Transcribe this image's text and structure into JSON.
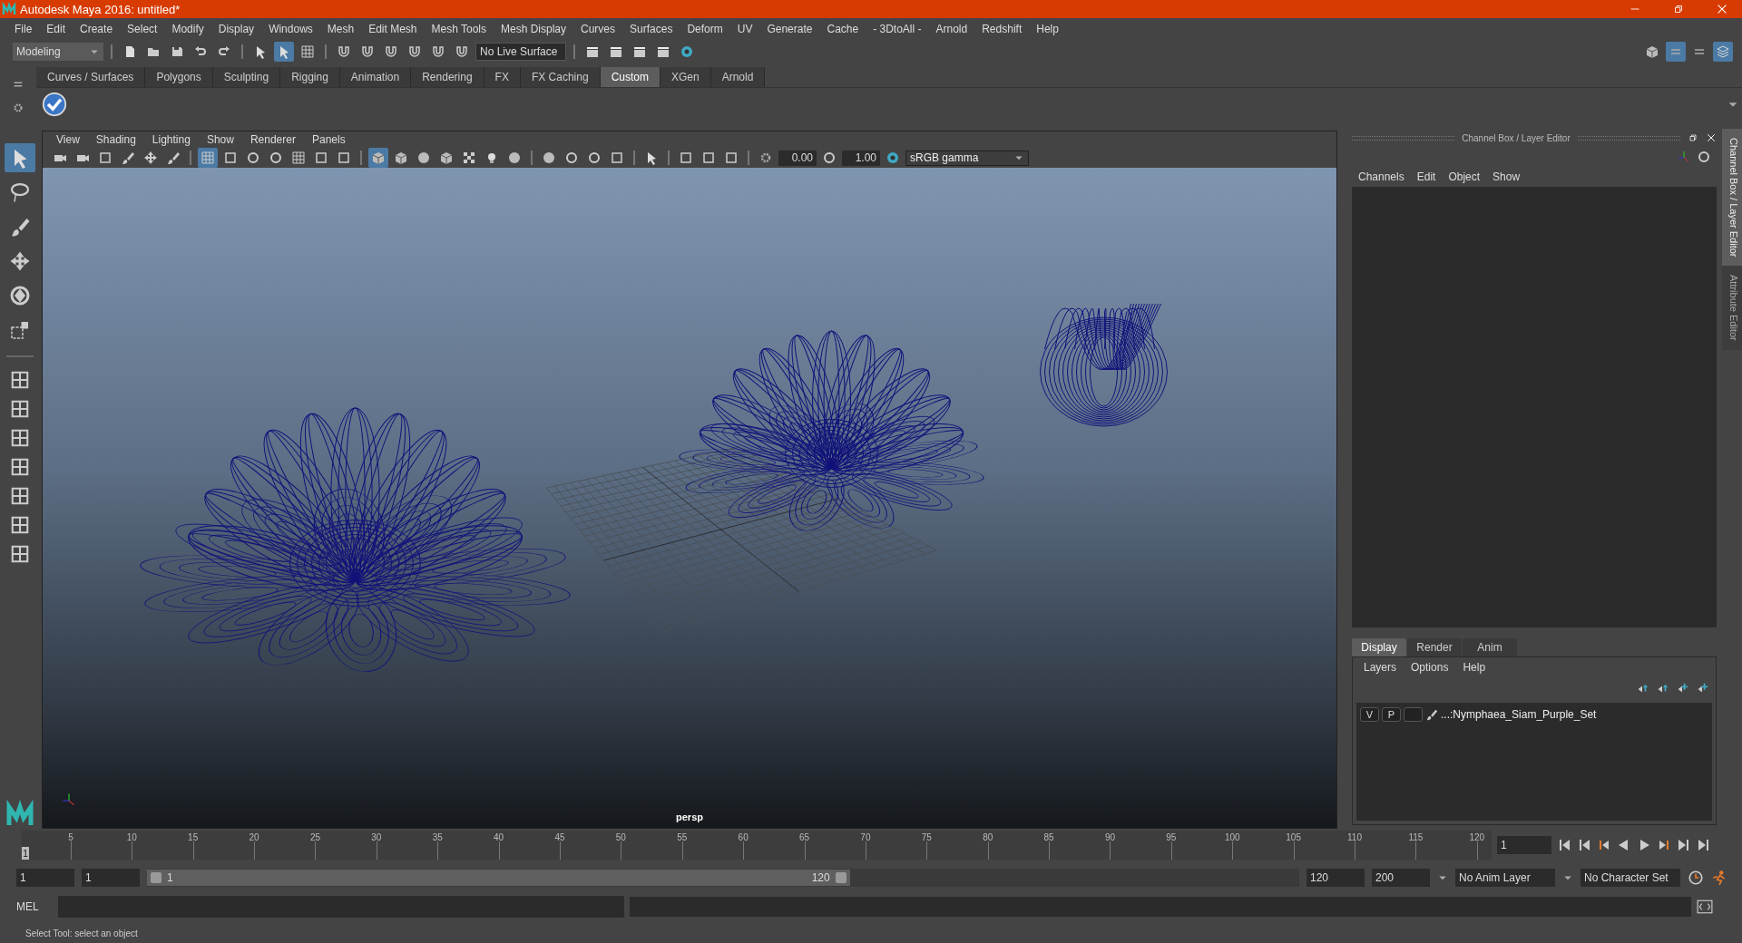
{
  "window": {
    "title": "Autodesk Maya 2016: untitled*"
  },
  "menu_bar": [
    "File",
    "Edit",
    "Create",
    "Select",
    "Modify",
    "Display",
    "Windows",
    "Mesh",
    "Edit Mesh",
    "Mesh Tools",
    "Mesh Display",
    "Curves",
    "Surfaces",
    "Deform",
    "UV",
    "Generate",
    "Cache",
    "- 3DtoAll -",
    "Arnold",
    "Redshift",
    "Help"
  ],
  "toolbar": {
    "mode": "Modeling",
    "live_surface": "No Live Surface"
  },
  "shelf_tabs": [
    {
      "label": "Curves / Surfaces",
      "selected": false
    },
    {
      "label": "Polygons",
      "selected": false
    },
    {
      "label": "Sculpting",
      "selected": false
    },
    {
      "label": "Rigging",
      "selected": false
    },
    {
      "label": "Animation",
      "selected": false
    },
    {
      "label": "Rendering",
      "selected": false
    },
    {
      "label": "FX",
      "selected": false
    },
    {
      "label": "FX Caching",
      "selected": false
    },
    {
      "label": "Custom",
      "selected": true
    },
    {
      "label": "XGen",
      "selected": false
    },
    {
      "label": "Arnold",
      "selected": false
    }
  ],
  "tools": [
    {
      "selected": true
    },
    {
      "selected": false
    },
    {
      "selected": false
    },
    {
      "selected": false
    },
    {
      "selected": false
    },
    {
      "selected": false
    }
  ],
  "viewport": {
    "menu": [
      "View",
      "Shading",
      "Lighting",
      "Show",
      "Renderer",
      "Panels"
    ],
    "exposure": "0.00",
    "gamma": "1.00",
    "color_space": "sRGB gamma",
    "camera_label": "persp"
  },
  "channel_box": {
    "title": "Channel Box / Layer Editor",
    "menu": [
      "Channels",
      "Edit",
      "Object",
      "Show"
    ],
    "side_tabs": [
      {
        "label": "Channel Box / Layer Editor",
        "selected": true
      },
      {
        "label": "Attribute Editor",
        "selected": false
      }
    ]
  },
  "layer_editor": {
    "tabs": [
      {
        "label": "Display",
        "selected": true
      },
      {
        "label": "Render",
        "selected": false
      },
      {
        "label": "Anim",
        "selected": false
      }
    ],
    "menu": [
      "Layers",
      "Options",
      "Help"
    ],
    "layers": [
      {
        "visible": "V",
        "playback": "P",
        "name": "...:Nymphaea_Siam_Purple_Set"
      }
    ]
  },
  "timeline": {
    "ticks": [
      "5",
      "10",
      "15",
      "20",
      "25",
      "30",
      "35",
      "40",
      "45",
      "50",
      "55",
      "60",
      "65",
      "70",
      "75",
      "80",
      "85",
      "90",
      "95",
      "100",
      "105",
      "110",
      "115",
      "120"
    ],
    "current_frame": "1",
    "frame_field": "1",
    "level": 0
  },
  "range": {
    "start": "1",
    "playback_start": "1",
    "slider_start": "1",
    "slider_end": "120",
    "playback_end": "120",
    "end": "200",
    "anim_layer": "No Anim Layer",
    "character_set": "No Character Set",
    "level": 0.61
  },
  "command_line": {
    "label": "MEL"
  },
  "status_bar": "Select Tool: select an object"
}
